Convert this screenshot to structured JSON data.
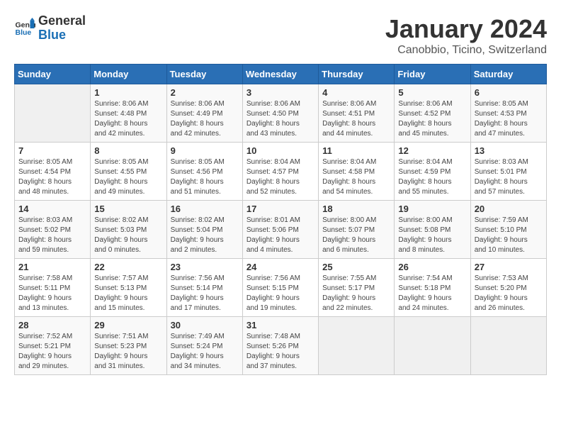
{
  "header": {
    "logo_general": "General",
    "logo_blue": "Blue",
    "title": "January 2024",
    "subtitle": "Canobbio, Ticino, Switzerland"
  },
  "weekdays": [
    "Sunday",
    "Monday",
    "Tuesday",
    "Wednesday",
    "Thursday",
    "Friday",
    "Saturday"
  ],
  "weeks": [
    [
      {
        "day": "",
        "info": ""
      },
      {
        "day": "1",
        "info": "Sunrise: 8:06 AM\nSunset: 4:48 PM\nDaylight: 8 hours\nand 42 minutes."
      },
      {
        "day": "2",
        "info": "Sunrise: 8:06 AM\nSunset: 4:49 PM\nDaylight: 8 hours\nand 42 minutes."
      },
      {
        "day": "3",
        "info": "Sunrise: 8:06 AM\nSunset: 4:50 PM\nDaylight: 8 hours\nand 43 minutes."
      },
      {
        "day": "4",
        "info": "Sunrise: 8:06 AM\nSunset: 4:51 PM\nDaylight: 8 hours\nand 44 minutes."
      },
      {
        "day": "5",
        "info": "Sunrise: 8:06 AM\nSunset: 4:52 PM\nDaylight: 8 hours\nand 45 minutes."
      },
      {
        "day": "6",
        "info": "Sunrise: 8:05 AM\nSunset: 4:53 PM\nDaylight: 8 hours\nand 47 minutes."
      }
    ],
    [
      {
        "day": "7",
        "info": "Sunrise: 8:05 AM\nSunset: 4:54 PM\nDaylight: 8 hours\nand 48 minutes."
      },
      {
        "day": "8",
        "info": "Sunrise: 8:05 AM\nSunset: 4:55 PM\nDaylight: 8 hours\nand 49 minutes."
      },
      {
        "day": "9",
        "info": "Sunrise: 8:05 AM\nSunset: 4:56 PM\nDaylight: 8 hours\nand 51 minutes."
      },
      {
        "day": "10",
        "info": "Sunrise: 8:04 AM\nSunset: 4:57 PM\nDaylight: 8 hours\nand 52 minutes."
      },
      {
        "day": "11",
        "info": "Sunrise: 8:04 AM\nSunset: 4:58 PM\nDaylight: 8 hours\nand 54 minutes."
      },
      {
        "day": "12",
        "info": "Sunrise: 8:04 AM\nSunset: 4:59 PM\nDaylight: 8 hours\nand 55 minutes."
      },
      {
        "day": "13",
        "info": "Sunrise: 8:03 AM\nSunset: 5:01 PM\nDaylight: 8 hours\nand 57 minutes."
      }
    ],
    [
      {
        "day": "14",
        "info": "Sunrise: 8:03 AM\nSunset: 5:02 PM\nDaylight: 8 hours\nand 59 minutes."
      },
      {
        "day": "15",
        "info": "Sunrise: 8:02 AM\nSunset: 5:03 PM\nDaylight: 9 hours\nand 0 minutes."
      },
      {
        "day": "16",
        "info": "Sunrise: 8:02 AM\nSunset: 5:04 PM\nDaylight: 9 hours\nand 2 minutes."
      },
      {
        "day": "17",
        "info": "Sunrise: 8:01 AM\nSunset: 5:06 PM\nDaylight: 9 hours\nand 4 minutes."
      },
      {
        "day": "18",
        "info": "Sunrise: 8:00 AM\nSunset: 5:07 PM\nDaylight: 9 hours\nand 6 minutes."
      },
      {
        "day": "19",
        "info": "Sunrise: 8:00 AM\nSunset: 5:08 PM\nDaylight: 9 hours\nand 8 minutes."
      },
      {
        "day": "20",
        "info": "Sunrise: 7:59 AM\nSunset: 5:10 PM\nDaylight: 9 hours\nand 10 minutes."
      }
    ],
    [
      {
        "day": "21",
        "info": "Sunrise: 7:58 AM\nSunset: 5:11 PM\nDaylight: 9 hours\nand 13 minutes."
      },
      {
        "day": "22",
        "info": "Sunrise: 7:57 AM\nSunset: 5:13 PM\nDaylight: 9 hours\nand 15 minutes."
      },
      {
        "day": "23",
        "info": "Sunrise: 7:56 AM\nSunset: 5:14 PM\nDaylight: 9 hours\nand 17 minutes."
      },
      {
        "day": "24",
        "info": "Sunrise: 7:56 AM\nSunset: 5:15 PM\nDaylight: 9 hours\nand 19 minutes."
      },
      {
        "day": "25",
        "info": "Sunrise: 7:55 AM\nSunset: 5:17 PM\nDaylight: 9 hours\nand 22 minutes."
      },
      {
        "day": "26",
        "info": "Sunrise: 7:54 AM\nSunset: 5:18 PM\nDaylight: 9 hours\nand 24 minutes."
      },
      {
        "day": "27",
        "info": "Sunrise: 7:53 AM\nSunset: 5:20 PM\nDaylight: 9 hours\nand 26 minutes."
      }
    ],
    [
      {
        "day": "28",
        "info": "Sunrise: 7:52 AM\nSunset: 5:21 PM\nDaylight: 9 hours\nand 29 minutes."
      },
      {
        "day": "29",
        "info": "Sunrise: 7:51 AM\nSunset: 5:23 PM\nDaylight: 9 hours\nand 31 minutes."
      },
      {
        "day": "30",
        "info": "Sunrise: 7:49 AM\nSunset: 5:24 PM\nDaylight: 9 hours\nand 34 minutes."
      },
      {
        "day": "31",
        "info": "Sunrise: 7:48 AM\nSunset: 5:26 PM\nDaylight: 9 hours\nand 37 minutes."
      },
      {
        "day": "",
        "info": ""
      },
      {
        "day": "",
        "info": ""
      },
      {
        "day": "",
        "info": ""
      }
    ]
  ]
}
